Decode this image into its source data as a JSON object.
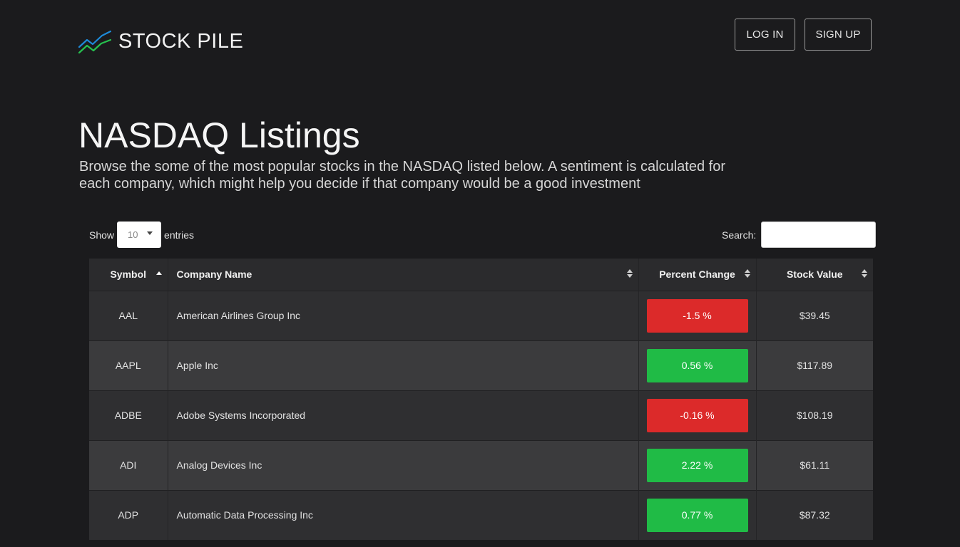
{
  "header": {
    "brand_name": "STOCK PILE",
    "login_label": "LOG IN",
    "signup_label": "SIGN UP"
  },
  "main": {
    "title": "NASDAQ Listings",
    "subtitle": "Browse the some of the most popular stocks in the NASDAQ listed below. A sentiment is calculated for each company, which might help you decide if that company would be a good investment"
  },
  "controls": {
    "show_label": "Show",
    "entries_value": "10",
    "entries_label": "entries",
    "search_label": "Search:",
    "search_value": ""
  },
  "table": {
    "columns": [
      "Symbol",
      "Company Name",
      "Percent Change",
      "Stock Value"
    ],
    "rows": [
      {
        "symbol": "AAL",
        "company": "American Airlines Group Inc",
        "change": "-1.5 %",
        "direction": "negative",
        "value": "$39.45"
      },
      {
        "symbol": "AAPL",
        "company": "Apple Inc",
        "change": "0.56 %",
        "direction": "positive",
        "value": "$117.89"
      },
      {
        "symbol": "ADBE",
        "company": "Adobe Systems Incorporated",
        "change": "-0.16 %",
        "direction": "negative",
        "value": "$108.19"
      },
      {
        "symbol": "ADI",
        "company": "Analog Devices Inc",
        "change": "2.22 %",
        "direction": "positive",
        "value": "$61.11"
      },
      {
        "symbol": "ADP",
        "company": "Automatic Data Processing Inc",
        "change": "0.77 %",
        "direction": "positive",
        "value": "$87.32"
      }
    ]
  },
  "colors": {
    "background": "#1b1b1d",
    "negative": "#dc2a2a",
    "positive": "#20bb46",
    "logo_blue": "#1e8ad8",
    "logo_green": "#26c24f"
  },
  "icons": {
    "logo": "stock-chart-logo-icon",
    "sort_asc": "sort-ascending-icon",
    "sort_both": "sort-both-icon",
    "select_caret": "caret-down-icon"
  }
}
